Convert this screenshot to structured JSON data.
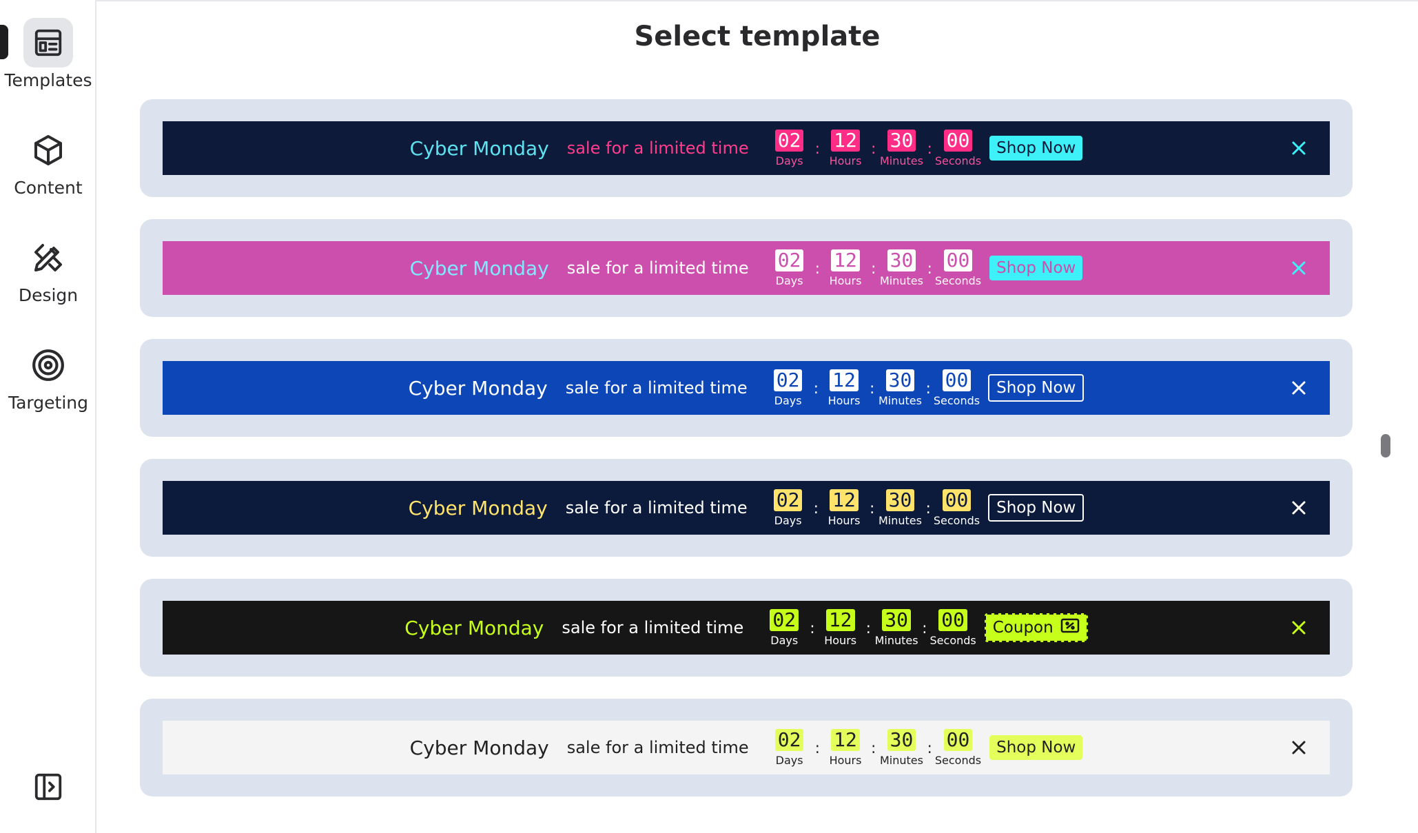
{
  "sidebar": {
    "items": [
      {
        "label": "Templates",
        "icon": "templates-icon",
        "active": true
      },
      {
        "label": "Content",
        "icon": "cube-icon"
      },
      {
        "label": "Design",
        "icon": "design-tools-icon"
      },
      {
        "label": "Targeting",
        "icon": "target-icon"
      }
    ],
    "collapse_icon": "sidebar-expand-icon"
  },
  "page": {
    "title": "Select template"
  },
  "templates": [
    {
      "headline": "Cyber Monday",
      "sub": "sale for a limited time",
      "timer": [
        {
          "num": "02",
          "label": "Days"
        },
        {
          "num": "12",
          "label": "Hours"
        },
        {
          "num": "30",
          "label": "Minutes"
        },
        {
          "num": "00",
          "label": "Seconds"
        }
      ],
      "cta": "Shop Now",
      "colors": {
        "bg": "#0d1a3a",
        "headline": "#5ee2f0",
        "sub": "#ff3d8b",
        "num_bg": "#ff2d86",
        "num_fg": "#ffffff",
        "label": "#ff4f9a",
        "cta_bg": "#3ef0f7",
        "cta_fg": "#0d1a3a",
        "close": "#3ef0f7"
      }
    },
    {
      "headline": "Cyber Monday",
      "sub": "sale for a limited time",
      "timer": [
        {
          "num": "02",
          "label": "Days"
        },
        {
          "num": "12",
          "label": "Hours"
        },
        {
          "num": "30",
          "label": "Minutes"
        },
        {
          "num": "00",
          "label": "Seconds"
        }
      ],
      "cta": "Shop Now",
      "colors": {
        "bg": "#cc4fad",
        "headline": "#7fe9ff",
        "sub": "#ffffff",
        "num_bg": "#ffffff",
        "num_fg": "#cc4fad",
        "label": "#ffffff",
        "cta_bg": "#3ef0f7",
        "cta_fg": "#cc4fad",
        "close": "#3ef0f7"
      }
    },
    {
      "headline": "Cyber Monday",
      "sub": "sale for a limited time",
      "timer": [
        {
          "num": "02",
          "label": "Days"
        },
        {
          "num": "12",
          "label": "Hours"
        },
        {
          "num": "30",
          "label": "Minutes"
        },
        {
          "num": "00",
          "label": "Seconds"
        }
      ],
      "cta": "Shop Now",
      "colors": {
        "bg": "#0d47b7",
        "headline": "#ffffff",
        "sub": "#ffffff",
        "num_bg": "#ffffff",
        "num_fg": "#0d47b7",
        "label": "#ffffff",
        "cta_bg": "transparent",
        "cta_fg": "#ffffff",
        "cta_border": "#ffffff",
        "close": "#ffffff"
      }
    },
    {
      "headline": "Cyber Monday",
      "sub": "sale for a limited time",
      "timer": [
        {
          "num": "02",
          "label": "Days"
        },
        {
          "num": "12",
          "label": "Hours"
        },
        {
          "num": "30",
          "label": "Minutes"
        },
        {
          "num": "00",
          "label": "Seconds"
        }
      ],
      "cta": "Shop Now",
      "colors": {
        "bg": "#0c1a3c",
        "headline": "#ffe36b",
        "sub": "#ffffff",
        "num_bg": "#ffe36b",
        "num_fg": "#0c1a3c",
        "label": "#ffffff",
        "cta_bg": "transparent",
        "cta_fg": "#ffffff",
        "cta_border": "#ffffff",
        "close": "#ffffff"
      }
    },
    {
      "headline": "Cyber Monday",
      "sub": "sale for a limited time",
      "timer": [
        {
          "num": "02",
          "label": "Days"
        },
        {
          "num": "12",
          "label": "Hours"
        },
        {
          "num": "30",
          "label": "Minutes"
        },
        {
          "num": "00",
          "label": "Seconds"
        }
      ],
      "cta": "Coupon",
      "cta_icon": "ticket-icon",
      "colors": {
        "bg": "#161616",
        "headline": "#c6ff1a",
        "sub": "#ffffff",
        "num_bg": "#c6ff1a",
        "num_fg": "#161616",
        "label": "#ffffff",
        "cta_bg": "#c6ff1a",
        "cta_fg": "#161616",
        "cta_border": "#161616",
        "close": "#c6ff1a"
      }
    },
    {
      "headline": "Cyber Monday",
      "sub": "sale for a limited time",
      "timer": [
        {
          "num": "02",
          "label": "Days"
        },
        {
          "num": "12",
          "label": "Hours"
        },
        {
          "num": "30",
          "label": "Minutes"
        },
        {
          "num": "00",
          "label": "Seconds"
        }
      ],
      "cta": "Shop Now",
      "colors": {
        "bg": "#f4f4f5",
        "headline": "#222222",
        "sub": "#222222",
        "num_bg": "#e4ff5c",
        "num_fg": "#222222",
        "label": "#222222",
        "cta_bg": "#e4ff5c",
        "cta_fg": "#222222",
        "close": "#222222"
      }
    }
  ]
}
